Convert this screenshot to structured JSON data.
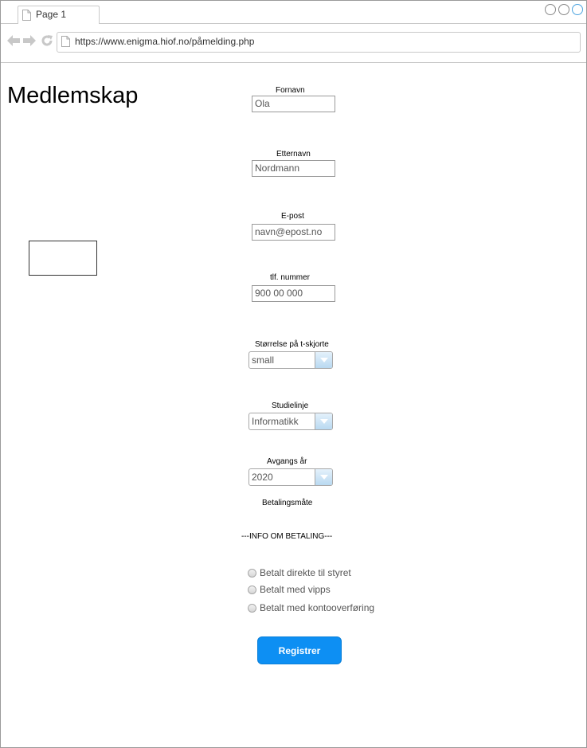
{
  "browser": {
    "tab_label": "Page 1",
    "url": "https://www.enigma.hiof.no/påmelding.php"
  },
  "page": {
    "title": "Medlemskap"
  },
  "form": {
    "fornavn": {
      "label": "Fornavn",
      "value": "Ola"
    },
    "etternavn": {
      "label": "Etternavn",
      "value": "Nordmann"
    },
    "epost": {
      "label": "E-post",
      "value": "navn@epost.no"
    },
    "tlf": {
      "label": "tlf. nummer",
      "value": "900 00 000"
    },
    "tshirt": {
      "label": "Størrelse på t-skjorte",
      "selected": "small"
    },
    "studielinje": {
      "label": "Studielinje",
      "selected": "Informatikk"
    },
    "avgangsaar": {
      "label": "Avgangs år",
      "selected": "2020"
    },
    "betaling": {
      "label": "Betalingsmåte",
      "info": "---INFO OM BETALING---",
      "options": [
        "Betalt direkte til styret",
        "Betalt med vipps",
        "Betalt med kontooverføring"
      ]
    },
    "submit_label": "Registrer"
  },
  "icons": {
    "tab": "page-icon",
    "back": "back-arrow-icon",
    "forward": "forward-arrow-icon",
    "reload": "reload-icon",
    "url": "page-icon",
    "dropdown": "chevron-down-icon"
  },
  "colors": {
    "submit_button": "#0d8ff3",
    "select_button": "#b9d9f1"
  }
}
